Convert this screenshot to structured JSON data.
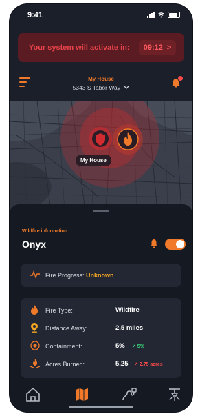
{
  "status": {
    "time": "9:41"
  },
  "alert": {
    "message": "Your system will activate in:",
    "timer": "09:12",
    "timer_arrow": ">"
  },
  "header": {
    "home_title": "My House",
    "address": "5343 S Tabor Way"
  },
  "map": {
    "marker_label": "My House"
  },
  "wildfire": {
    "section_label": "Wildfire information",
    "name": "Onyx",
    "progress_label": "Fire Progress:",
    "progress_value": "Unknown",
    "rows": [
      {
        "key": "Fire Type:",
        "value": "Wildfire",
        "delta": ""
      },
      {
        "key": "Distance Away:",
        "value": "2.5 miles",
        "delta": ""
      },
      {
        "key": "Containment:",
        "value": "5%",
        "delta": "↗ 5%"
      },
      {
        "key": "Acres Burned:",
        "value": "5.25",
        "delta": "↗ 2.75 acres"
      }
    ]
  },
  "nav": {
    "items": [
      "home-icon",
      "map-icon",
      "hose-icon",
      "sprinkler-icon"
    ]
  },
  "colors": {
    "accent": "#f07a2a",
    "alert_bg": "#5a1c22",
    "alert_text": "#e8434a",
    "progress": "#f5a623",
    "delta_up_green": "#3bd37a",
    "delta_up_red": "#ff4b4b"
  }
}
